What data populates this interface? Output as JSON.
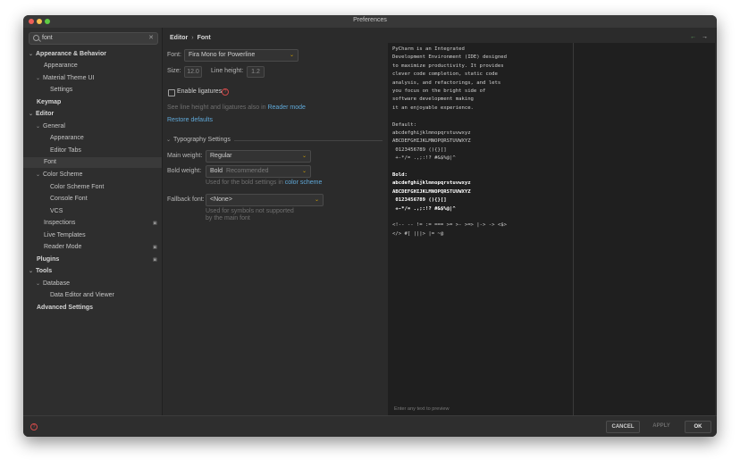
{
  "window": {
    "title": "Preferences"
  },
  "search": {
    "value": "font",
    "clear": "✕"
  },
  "tree": [
    {
      "label": "Appearance & Behavior",
      "bold": true,
      "chev": "⌄"
    },
    {
      "label": "Appearance"
    },
    {
      "label": "Material Theme UI",
      "chev": "⌄"
    },
    {
      "label": "Settings"
    },
    {
      "label": "Keymap",
      "bold": true
    },
    {
      "label": "Editor",
      "bold": true,
      "chev": "⌄"
    },
    {
      "label": "General",
      "chev": "⌄"
    },
    {
      "label": "Appearance"
    },
    {
      "label": "Editor Tabs"
    },
    {
      "label": "Font",
      "selected": true
    },
    {
      "label": "Color Scheme",
      "chev": "⌄"
    },
    {
      "label": "Color Scheme Font"
    },
    {
      "label": "Console Font"
    },
    {
      "label": "VCS"
    },
    {
      "label": "Inspections"
    },
    {
      "label": "Live Templates"
    },
    {
      "label": "Reader Mode"
    },
    {
      "label": "Plugins",
      "bold": true
    },
    {
      "label": "Tools",
      "bold": true,
      "chev": "⌄"
    },
    {
      "label": "Database",
      "chev": "⌄"
    },
    {
      "label": "Data Editor and Viewer"
    },
    {
      "label": "Advanced Settings",
      "bold": true
    }
  ],
  "tree_ext_icon": "▣",
  "breadcrumb": {
    "parent": "Editor",
    "sep": "›",
    "current": "Font"
  },
  "nav": {
    "back": "←",
    "forward": "→"
  },
  "font_settings": {
    "font_label": "Font:",
    "font_value": "Fira Mono for Powerline",
    "size_label": "Size:",
    "size_value": "12.0",
    "line_height_label": "Line height:",
    "line_height_value": "1.2",
    "ligatures_label": "Enable ligatures",
    "reader_hint": "See line height and ligatures also in",
    "reader_link": "Reader mode",
    "restore_defaults": "Restore defaults"
  },
  "typography": {
    "title": "Typography Settings",
    "main_weight_label": "Main weight:",
    "main_weight_value": "Regular",
    "bold_weight_label": "Bold weight:",
    "bold_weight_value": "Bold",
    "bold_weight_sub": "Recommended",
    "bold_hint": "Used for the bold settings in",
    "bold_hint_link": "color scheme",
    "fallback_label": "Fallback font:",
    "fallback_value": "<None>",
    "fallback_hint_1": "Used for symbols not supported",
    "fallback_hint_2": "by the main font"
  },
  "preview": {
    "lines": [
      "PyCharm is an Integrated",
      "Development Environment (IDE) designed",
      "to maximize productivity. It provides",
      "clever code completion, static code",
      "analysis, and refactorings, and lets",
      "you focus on the bright side of",
      "software development making",
      "it an enjoyable experience.",
      "",
      "Default:",
      "abcdefghijklmnopqrstuvwxyz",
      "ABCDEFGHIJKLMNOPQRSTUVWXYZ",
      " 0123456789 (){}[]",
      " +-*/= .,;:!? #&$%@|^",
      "",
      "Bold:",
      "abcdefghijklmnopqrstuvwxyz",
      "ABCDEFGHIJKLMNOPQRSTUVWXYZ",
      " 0123456789 (){}[]",
      " +-*/= .,;:!? #&$%@|^",
      "",
      "<!-- -- != := === >= >- >=> |-> -> <$>",
      "</> #[ |||> |= ~@"
    ],
    "footer": "Enter any text to preview"
  },
  "buttons": {
    "cancel": "CANCEL",
    "apply": "APPLY",
    "ok": "OK",
    "help": "?"
  }
}
